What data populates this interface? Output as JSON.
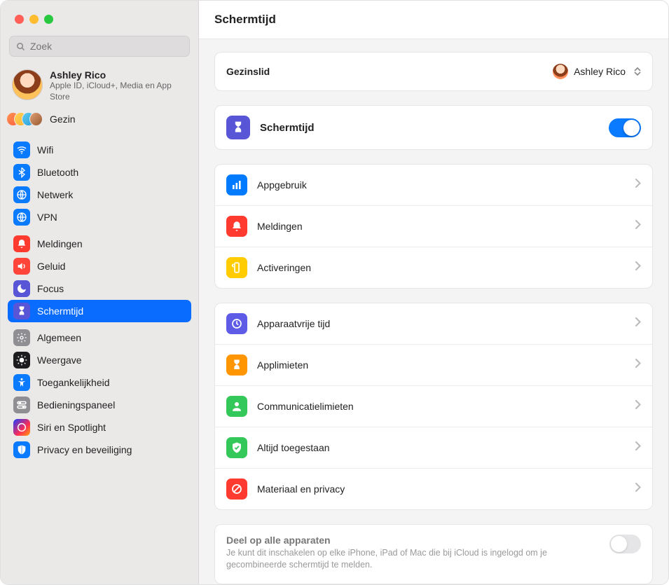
{
  "window": {
    "title": "Schermtijd"
  },
  "search": {
    "placeholder": "Zoek"
  },
  "account": {
    "name": "Ashley Rico",
    "subtitle": "Apple ID, iCloud+, Media en App Store"
  },
  "family": {
    "label": "Gezin"
  },
  "sidebar": {
    "groups": [
      {
        "items": [
          {
            "id": "wifi",
            "label": "Wifi",
            "iconColor": "ic-blue"
          },
          {
            "id": "bluetooth",
            "label": "Bluetooth",
            "iconColor": "ic-blue"
          },
          {
            "id": "network",
            "label": "Netwerk",
            "iconColor": "ic-blue"
          },
          {
            "id": "vpn",
            "label": "VPN",
            "iconColor": "ic-blue"
          }
        ]
      },
      {
        "items": [
          {
            "id": "notifications",
            "label": "Meldingen",
            "iconColor": "ic-red"
          },
          {
            "id": "sound",
            "label": "Geluid",
            "iconColor": "ic-audred"
          },
          {
            "id": "focus",
            "label": "Focus",
            "iconColor": "ic-indigo"
          },
          {
            "id": "screentime",
            "label": "Schermtijd",
            "iconColor": "ic-indigo",
            "active": true
          }
        ]
      },
      {
        "items": [
          {
            "id": "general",
            "label": "Algemeen",
            "iconColor": "ic-grey"
          },
          {
            "id": "display",
            "label": "Weergave",
            "iconColor": "ic-black"
          },
          {
            "id": "accessibility",
            "label": "Toegankelijkheid",
            "iconColor": "ic-blue"
          },
          {
            "id": "controlcenter",
            "label": "Bedieningspaneel",
            "iconColor": "ic-grey"
          },
          {
            "id": "siri",
            "label": "Siri en Spotlight",
            "iconColor": "ic-siri"
          },
          {
            "id": "privacy",
            "label": "Privacy en beveiliging",
            "iconColor": "ic-blue"
          }
        ]
      }
    ]
  },
  "main": {
    "family_member": {
      "label": "Gezinslid",
      "selected": "Ashley Rico"
    },
    "screentime_row": {
      "label": "Schermtijd",
      "on": true
    },
    "section_usage": [
      {
        "id": "appusage",
        "label": "Appgebruik",
        "iconColor": "ic-darkblue"
      },
      {
        "id": "notifications",
        "label": "Meldingen",
        "iconColor": "ic-red"
      },
      {
        "id": "pickups",
        "label": "Activeringen",
        "iconColor": "ic-yellow"
      }
    ],
    "section_limits": [
      {
        "id": "downtime",
        "label": "Apparaatvrije tijd",
        "iconColor": "ic-purple"
      },
      {
        "id": "applimits",
        "label": "Applimieten",
        "iconColor": "ic-orange"
      },
      {
        "id": "commlimits",
        "label": "Communicatielimieten",
        "iconColor": "ic-green"
      },
      {
        "id": "allowed",
        "label": "Altijd toegestaan",
        "iconColor": "ic-green"
      },
      {
        "id": "content",
        "label": "Materiaal en privacy",
        "iconColor": "ic-red"
      }
    ],
    "share": {
      "title": "Deel op alle apparaten",
      "desc": "Je kunt dit inschakelen op elke iPhone, iPad of Mac die bij iCloud is ingelogd om je gecombineerde schermtijd te melden.",
      "on": false,
      "disabled": true
    }
  }
}
